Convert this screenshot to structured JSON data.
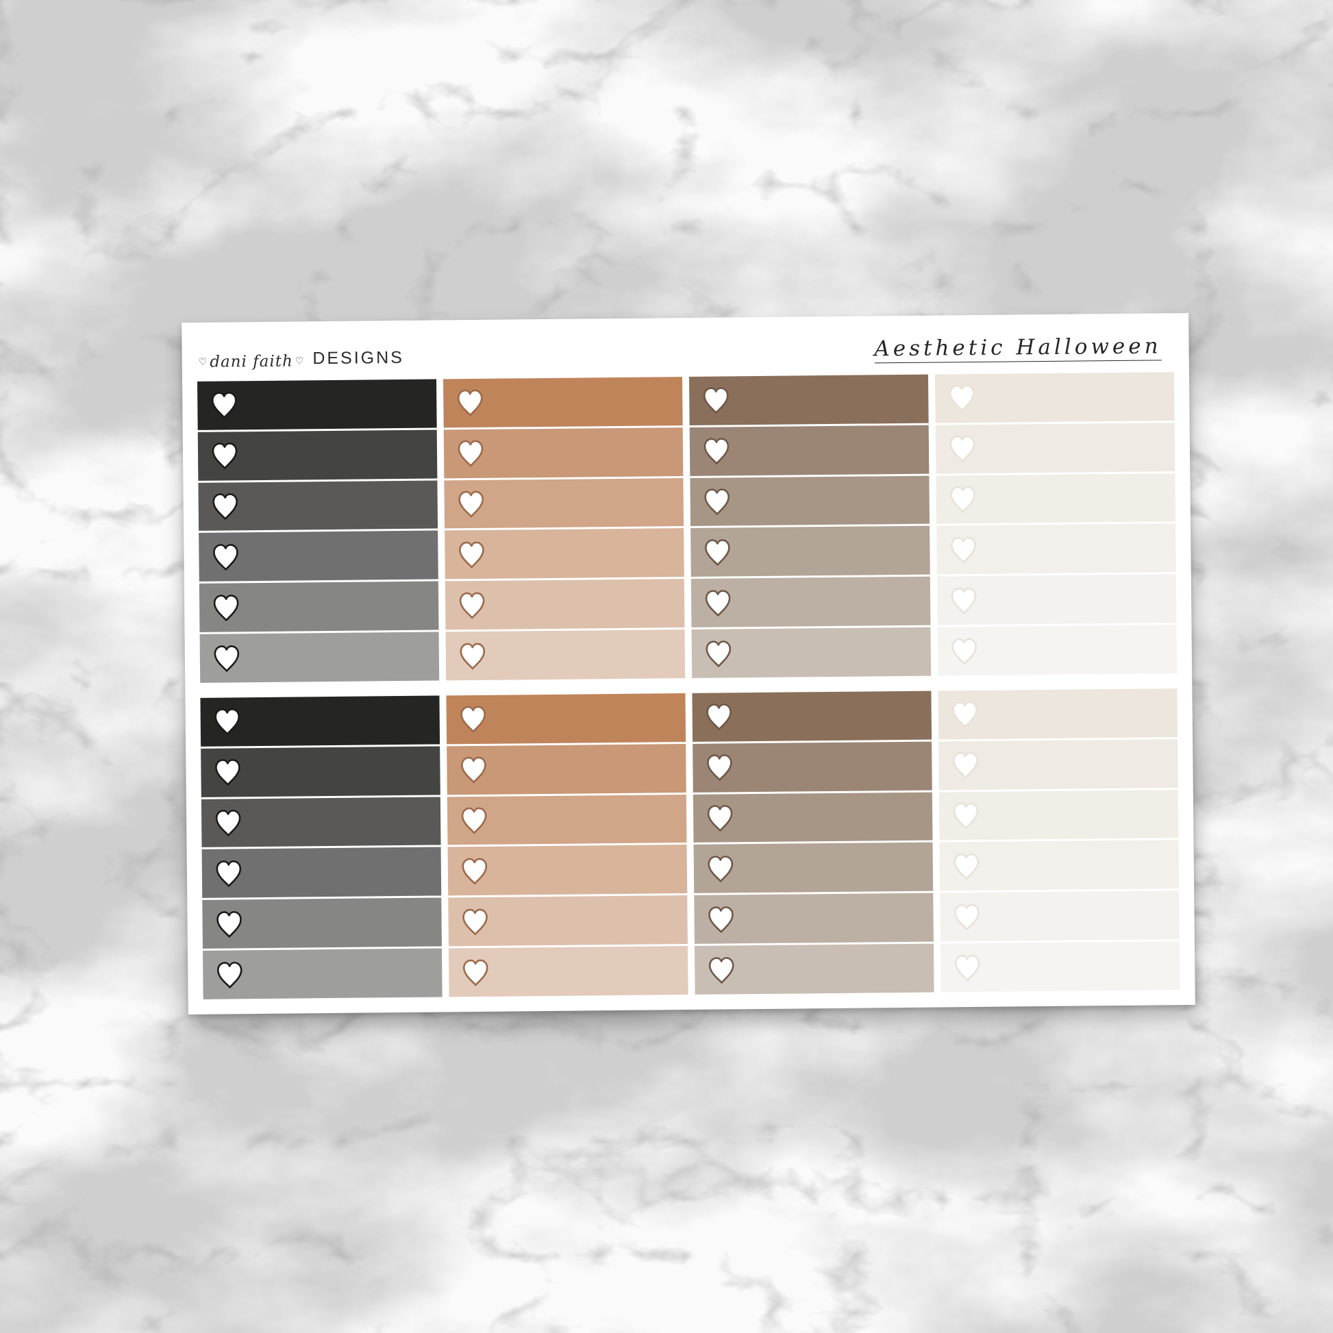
{
  "sheet": {
    "brand_script": "dani faith",
    "brand_word": "DESIGNS",
    "title": "Aesthetic Halloween"
  },
  "columns": [
    {
      "name": "grey",
      "colors": [
        "#252523",
        "#444442",
        "#5a5958",
        "#707070",
        "#868685",
        "#9e9e9d"
      ],
      "heart_fill": "#ffffff",
      "heart_stroke": "#1a1a1a"
    },
    {
      "name": "caramel",
      "colors": [
        "#c0845b",
        "#c99877",
        "#d1a587",
        "#d8b49b",
        "#ddc0ac",
        "#e2cbbb"
      ],
      "heart_fill": "#ffffff",
      "heart_stroke": "#9b6a4a"
    },
    {
      "name": "taupe",
      "colors": [
        "#8a6f5a",
        "#9b8676",
        "#a79686",
        "#b2a496",
        "#bcb0a4",
        "#c9beb3"
      ],
      "heart_fill": "#ffffff",
      "heart_stroke": "#6e5848"
    },
    {
      "name": "cream",
      "colors": [
        "#ece6dd",
        "#efebe4",
        "#f1ede7",
        "#f3f0eb",
        "#f4f2ee",
        "#f6f4f0"
      ],
      "heart_fill": "#ffffff",
      "heart_stroke": "#e8e2d9"
    }
  ]
}
